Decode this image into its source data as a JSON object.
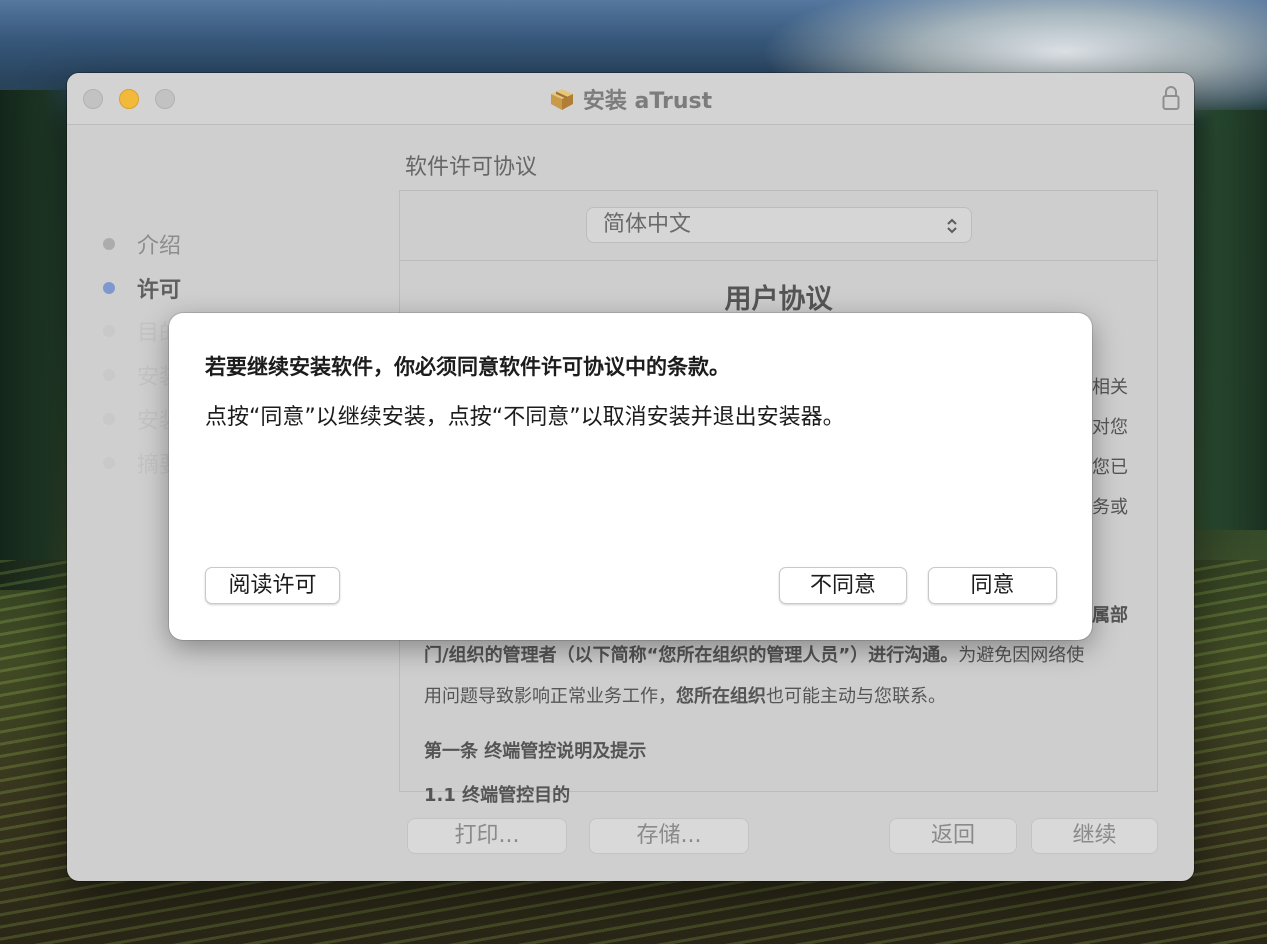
{
  "window": {
    "title": "安装 aTrust"
  },
  "sidebar": {
    "items": [
      {
        "label": "介绍"
      },
      {
        "label": "许可"
      },
      {
        "label": "目的"
      },
      {
        "label": "安装"
      },
      {
        "label": "安装"
      },
      {
        "label": "摘要"
      }
    ]
  },
  "main": {
    "section_title": "软件许可协议",
    "language_select": {
      "value": "简体中文"
    },
    "document": {
      "title": "用户协议",
      "right_fragments": [
        "相关",
        "对您",
        "您已",
        "务或",
        "属部"
      ],
      "lines": [
        {
          "bold": "门/组织的管理者（以下简称“您所在组织的管理人员”）进行沟通。",
          "normal": "为避免因网络使"
        },
        {
          "normal": "用问题导致影响正常业务工作，",
          "bold": "您所在组织",
          "normal2": "也可能主动与您联系。"
        },
        {
          "bold": "第一条 终端管控说明及提示"
        },
        {
          "bold": "1.1 终端管控目的"
        }
      ]
    }
  },
  "toolbar": {
    "print_label": "打印...",
    "save_label": "存储...",
    "back_label": "返回",
    "continue_label": "继续"
  },
  "dialog": {
    "heading": "若要继续安装软件，你必须同意软件许可协议中的条款。",
    "message": "点按“同意”以继续安装，点按“不同意”以取消安装并退出安装器。",
    "read_license_label": "阅读许可",
    "disagree_label": "不同意",
    "agree_label": "同意"
  }
}
